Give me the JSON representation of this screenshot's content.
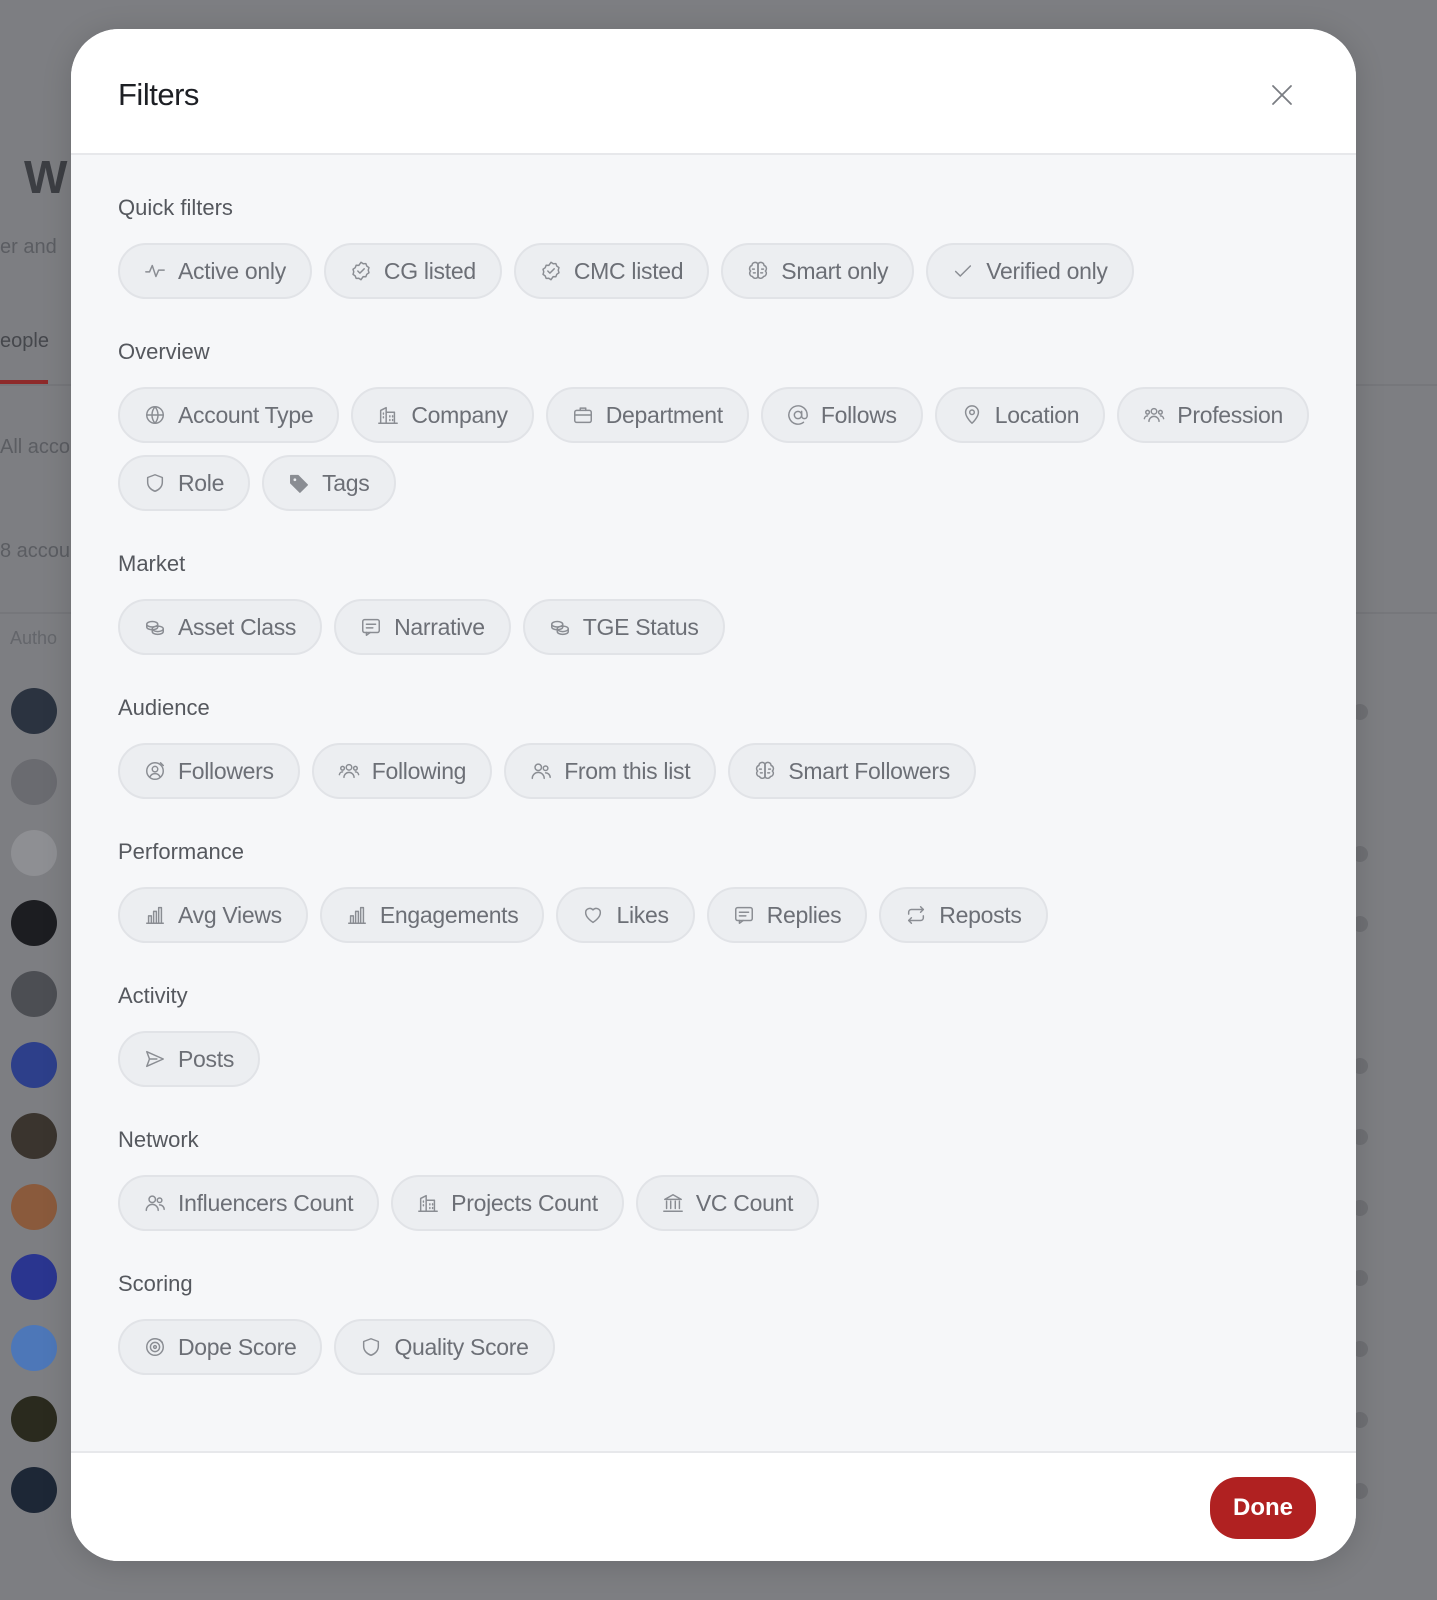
{
  "background": {
    "page_title": "W",
    "subtitle": "er and",
    "tab_label": "eople",
    "filter_text": "All acco",
    "count_text": "8 accou",
    "column_header": "Autho"
  },
  "modal": {
    "title": "Filters",
    "done_label": "Done",
    "sections": [
      {
        "title": "Quick filters",
        "chips": [
          {
            "label": "Active only",
            "icon": "activity-icon"
          },
          {
            "label": "CG listed",
            "icon": "badge-check-icon"
          },
          {
            "label": "CMC listed",
            "icon": "badge-check-icon"
          },
          {
            "label": "Smart only",
            "icon": "brain-icon"
          },
          {
            "label": "Verified only",
            "icon": "check-icon"
          }
        ]
      },
      {
        "title": "Overview",
        "chips": [
          {
            "label": "Account Type",
            "icon": "globe-icon"
          },
          {
            "label": "Company",
            "icon": "building-icon"
          },
          {
            "label": "Department",
            "icon": "briefcase-icon"
          },
          {
            "label": "Follows",
            "icon": "at-sign-icon"
          },
          {
            "label": "Location",
            "icon": "map-pin-icon"
          },
          {
            "label": "Profession",
            "icon": "users-group-icon"
          },
          {
            "label": "Role",
            "icon": "shield-icon"
          },
          {
            "label": "Tags",
            "icon": "tag-icon"
          }
        ]
      },
      {
        "title": "Market",
        "chips": [
          {
            "label": "Asset Class",
            "icon": "coins-icon"
          },
          {
            "label": "Narrative",
            "icon": "message-square-icon"
          },
          {
            "label": "TGE Status",
            "icon": "coins-icon"
          }
        ]
      },
      {
        "title": "Audience",
        "chips": [
          {
            "label": "Followers",
            "icon": "user-target-icon"
          },
          {
            "label": "Following",
            "icon": "users-group-icon"
          },
          {
            "label": "From this list",
            "icon": "users-icon"
          },
          {
            "label": "Smart Followers",
            "icon": "brain-icon"
          }
        ]
      },
      {
        "title": "Performance",
        "chips": [
          {
            "label": "Avg Views",
            "icon": "bar-chart-icon"
          },
          {
            "label": "Engagements",
            "icon": "bar-chart-icon"
          },
          {
            "label": "Likes",
            "icon": "heart-icon"
          },
          {
            "label": "Replies",
            "icon": "message-square-icon"
          },
          {
            "label": "Reposts",
            "icon": "repeat-icon"
          }
        ]
      },
      {
        "title": "Activity",
        "chips": [
          {
            "label": "Posts",
            "icon": "send-icon"
          }
        ]
      },
      {
        "title": "Network",
        "chips": [
          {
            "label": "Influencers Count",
            "icon": "users-icon"
          },
          {
            "label": "Projects Count",
            "icon": "building-icon"
          },
          {
            "label": "VC Count",
            "icon": "landmark-icon"
          }
        ]
      },
      {
        "title": "Scoring",
        "chips": [
          {
            "label": "Dope Score",
            "icon": "target-icon"
          },
          {
            "label": "Quality Score",
            "icon": "shield-icon"
          }
        ]
      }
    ]
  },
  "colors": {
    "accent": "#b02121",
    "overlay": "#7d7e82",
    "chip_bg": "#eceef1",
    "chip_text": "#6c6f76"
  }
}
